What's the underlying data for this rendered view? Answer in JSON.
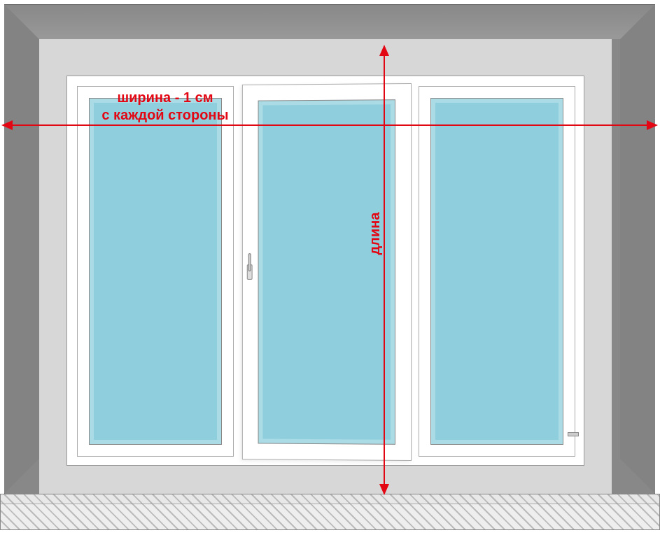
{
  "diagram": {
    "glass_color": "#8fcfdd",
    "arrow_color": "#e30613",
    "wall_color": "#888888",
    "recess_color": "#d7d7d7"
  },
  "labels": {
    "width_line1": "ширина - 1 см",
    "width_line2": "с каждой стороны",
    "length": "длина"
  },
  "icons": {
    "handle": "window-handle-icon"
  }
}
